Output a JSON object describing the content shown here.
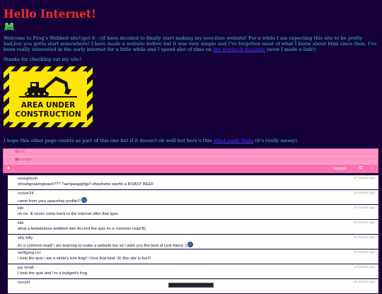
{
  "header": {
    "title": "Hello Internet!"
  },
  "intro": {
    "text_1": "Welcome to Frog's Webbed site!(get it :-))I have decided to finally start making my neocities website! For a while I am expecting this site to be pretty bad,but you gotta start somewhere! I have made a website before but it was very simple and I've forgotten most of what I know about html since then. I've been really interested in the early internet for a little while and I spend alot of time on",
    "link_text": "the wayback machine",
    "text_2": "(wow I made a link!)"
  },
  "thanks": "thanks for checking out my site!",
  "construction": {
    "line1": "AREA UNDER",
    "line2": "CONSTRUCTION"
  },
  "other_pages": {
    "text_1": "I hope this other page counts as part of this one but if it doesn't oh well but here's this",
    "link_text": "other page thing",
    "text_2": "(it's really messy)"
  },
  "comment_form": {
    "name_placeholder": "name",
    "message_placeholder": "message",
    "upgrade_label": "Upgrade"
  },
  "comments": [
    {
      "name": "ussughonh",
      "time": "17 months ago",
      "text": "ohouhgoaiehgioaeh??? ?aei'gaegajhijp!! eheahehe eaehh a ROAST BEEF",
      "emoji": false
    },
    {
      "name": "rocker24",
      "time": "18 months ago",
      "text": "came from your spacehey profile!!!",
      "emoji": true
    },
    {
      "name": "kiki",
      "time": "20 months ago",
      "text": "oh no. ill never come back to the internet after that typo.",
      "emoji": false
    },
    {
      "name": "kiki",
      "time": "20 months ago",
      "text": "what a fantabulous webbed site! Accord the quiz im a common road B)",
      "emoji": false
    },
    {
      "name": "silly billy",
      "time": "21 months ago",
      "text": "im a common toad! i am learning to make a website too so i wish you the best of luck friend :)",
      "emoji": true
    },
    {
      "name": "wolfgang.ccr",
      "time": "22 months ago",
      "text": "i took the quiz i am a white's tree frog!! i love that kind :3c this site is fun!!!",
      "emoji": false
    },
    {
      "name": "jay small",
      "time": "22 months ago",
      "text": "I took the quiz and I'm a budgett's frog",
      "emoji": false
    },
    {
      "name": "sunset",
      "time": "26 months ago",
      "text": "",
      "emoji": false
    }
  ],
  "colors": {
    "background": "#15003a",
    "title": "#ff2a2a",
    "text": "#38d3c0",
    "link": "#4545ff",
    "form_pink": "#ff95c4",
    "toolbar_pink": "#ff6fae"
  }
}
